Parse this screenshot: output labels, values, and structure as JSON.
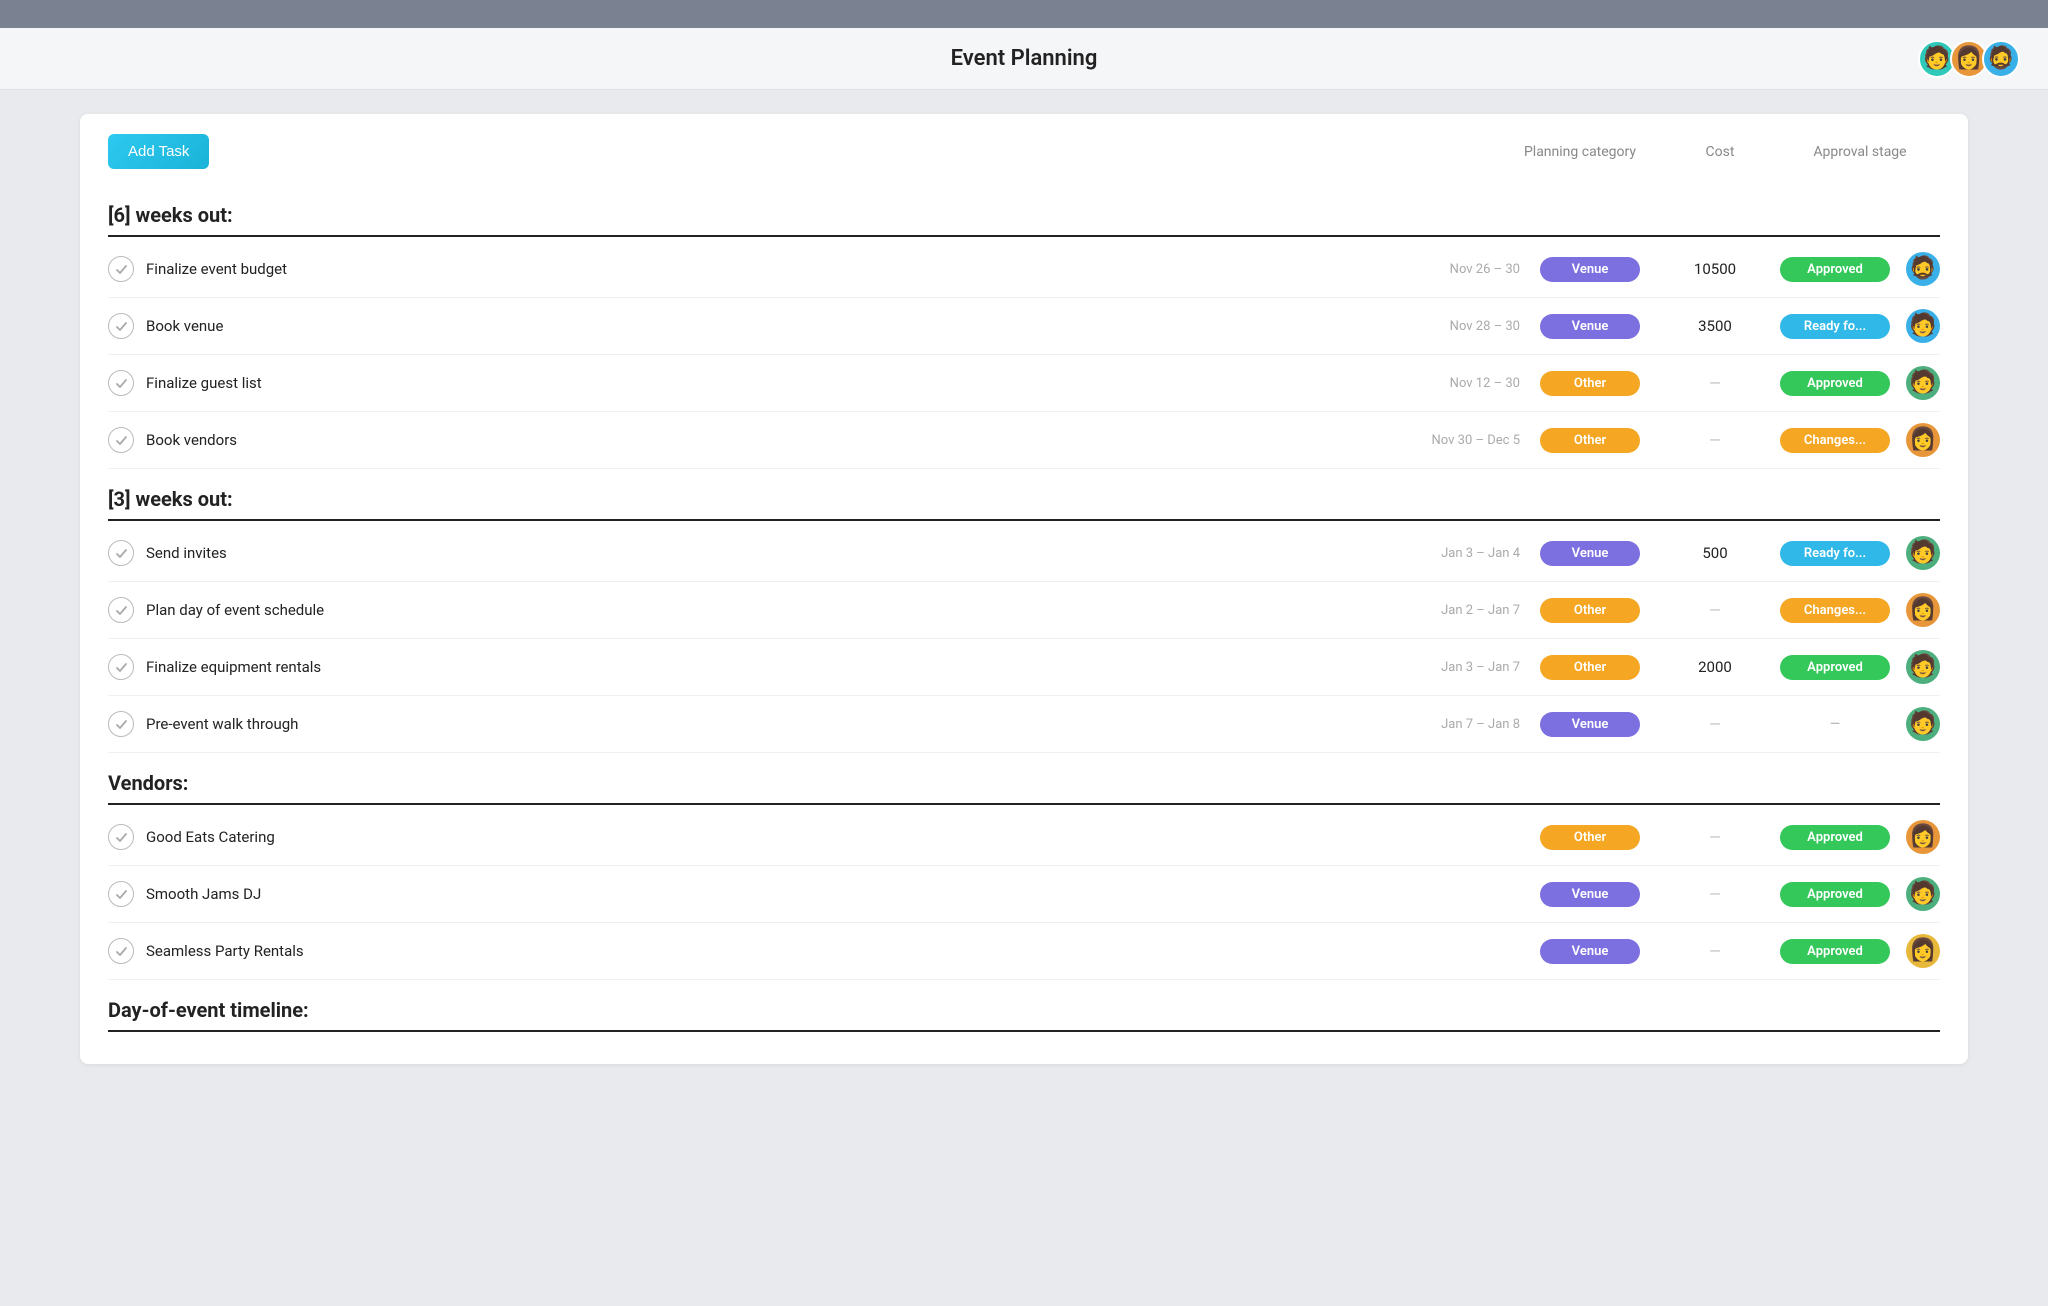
{
  "topBar": {},
  "header": {
    "title": "Event Planning",
    "avatars": [
      {
        "id": "avatar-1",
        "emoji": "🧑",
        "bg": "#2ec9b8"
      },
      {
        "id": "avatar-2",
        "emoji": "👩",
        "bg": "#e8963a"
      },
      {
        "id": "avatar-3",
        "emoji": "🧔",
        "bg": "#3ab0e8"
      }
    ]
  },
  "toolbar": {
    "add_task_label": "Add Task",
    "col_planning": "Planning category",
    "col_cost": "Cost",
    "col_approval": "Approval stage"
  },
  "sections": [
    {
      "id": "section-6weeks",
      "title": "[6] weeks out:",
      "tasks": [
        {
          "id": "task-1",
          "name": "Finalize event budget",
          "date": "Nov 26 – 30",
          "category": "Venue",
          "category_type": "venue",
          "cost": "10500",
          "approval": "Approved",
          "approval_type": "approved",
          "avatar_emoji": "🧔",
          "avatar_bg": "#3ab0e8"
        },
        {
          "id": "task-2",
          "name": "Book venue",
          "date": "Nov 28 – 30",
          "category": "Venue",
          "category_type": "venue",
          "cost": "3500",
          "approval": "Ready fo...",
          "approval_type": "ready",
          "avatar_emoji": "🧑",
          "avatar_bg": "#3ab0e8"
        },
        {
          "id": "task-3",
          "name": "Finalize guest list",
          "date": "Nov 12 – 30",
          "category": "Other",
          "category_type": "other",
          "cost": "—",
          "approval": "Approved",
          "approval_type": "approved",
          "avatar_emoji": "🧑",
          "avatar_bg": "#4caf7d"
        },
        {
          "id": "task-4",
          "name": "Book vendors",
          "date": "Nov 30 – Dec 5",
          "category": "Other",
          "category_type": "other",
          "cost": "—",
          "approval": "Changes...",
          "approval_type": "changes",
          "avatar_emoji": "👩",
          "avatar_bg": "#e8963a"
        }
      ]
    },
    {
      "id": "section-3weeks",
      "title": "[3] weeks out:",
      "tasks": [
        {
          "id": "task-5",
          "name": "Send invites",
          "date": "Jan 3 – Jan 4",
          "category": "Venue",
          "category_type": "venue",
          "cost": "500",
          "approval": "Ready fo...",
          "approval_type": "ready",
          "avatar_emoji": "🧑",
          "avatar_bg": "#4caf7d"
        },
        {
          "id": "task-6",
          "name": "Plan day of event schedule",
          "date": "Jan 2 – Jan 7",
          "category": "Other",
          "category_type": "other",
          "cost": "—",
          "approval": "Changes...",
          "approval_type": "changes",
          "avatar_emoji": "👩",
          "avatar_bg": "#e8963a"
        },
        {
          "id": "task-7",
          "name": "Finalize equipment rentals",
          "date": "Jan 3 – Jan 7",
          "category": "Other",
          "category_type": "other",
          "cost": "2000",
          "approval": "Approved",
          "approval_type": "approved",
          "avatar_emoji": "🧑",
          "avatar_bg": "#4caf7d"
        },
        {
          "id": "task-8",
          "name": "Pre-event walk through",
          "date": "Jan 7 – Jan 8",
          "category": "Venue",
          "category_type": "venue",
          "cost": "—",
          "approval": "—",
          "approval_type": "none",
          "avatar_emoji": "🧑",
          "avatar_bg": "#4caf7d"
        }
      ]
    },
    {
      "id": "section-vendors",
      "title": "Vendors:",
      "tasks": [
        {
          "id": "task-9",
          "name": "Good Eats Catering",
          "date": "",
          "category": "Other",
          "category_type": "other",
          "cost": "—",
          "approval": "Approved",
          "approval_type": "approved",
          "avatar_emoji": "👩",
          "avatar_bg": "#e8963a"
        },
        {
          "id": "task-10",
          "name": "Smooth Jams DJ",
          "date": "",
          "category": "Venue",
          "category_type": "venue",
          "cost": "—",
          "approval": "Approved",
          "approval_type": "approved",
          "avatar_emoji": "🧑",
          "avatar_bg": "#4caf7d"
        },
        {
          "id": "task-11",
          "name": "Seamless Party Rentals",
          "date": "",
          "category": "Venue",
          "category_type": "venue",
          "cost": "—",
          "approval": "Approved",
          "approval_type": "approved",
          "avatar_emoji": "👩",
          "avatar_bg": "#e8b83a"
        }
      ]
    },
    {
      "id": "section-day-of",
      "title": "Day-of-event timeline:",
      "tasks": []
    }
  ]
}
